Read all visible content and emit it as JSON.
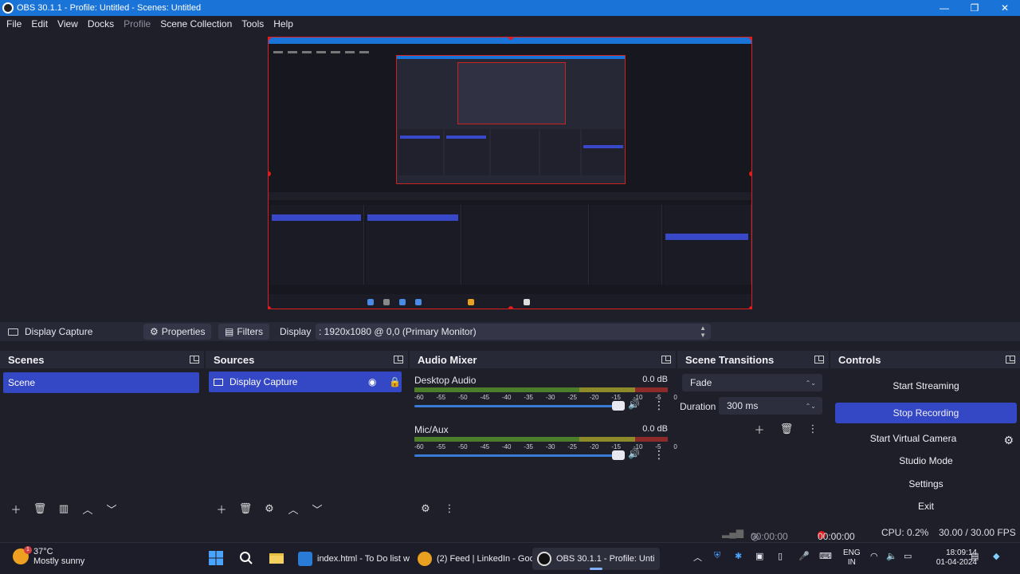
{
  "window": {
    "title": "OBS 30.1.1 - Profile: Untitled - Scenes: Untitled",
    "minimize": "—",
    "maximize": "❐",
    "close": "✕"
  },
  "menu": [
    "File",
    "Edit",
    "View",
    "Docks",
    "Profile",
    "Scene Collection",
    "Tools",
    "Help"
  ],
  "source_toolbar": {
    "source_name": "Display Capture",
    "properties": "Properties",
    "filters": "Filters",
    "display_label": "Display",
    "display_value": ": 1920x1080 @ 0,0 (Primary Monitor)"
  },
  "scenes": {
    "title": "Scenes",
    "items": [
      "Scene"
    ]
  },
  "sources": {
    "title": "Sources",
    "items": [
      "Display Capture"
    ]
  },
  "audio_mixer": {
    "title": "Audio Mixer",
    "channels": [
      {
        "name": "Desktop Audio",
        "db": "0.0 dB",
        "volume": 1.0
      },
      {
        "name": "Mic/Aux",
        "db": "0.0 dB",
        "volume": 1.0
      }
    ],
    "scale": [
      "-60",
      "-55",
      "-50",
      "-45",
      "-40",
      "-35",
      "-30",
      "-25",
      "-20",
      "-15",
      "-10",
      "-5",
      "0"
    ]
  },
  "transitions": {
    "title": "Scene Transitions",
    "selected": "Fade",
    "duration_label": "Duration",
    "duration_value": "300 ms"
  },
  "controls": {
    "title": "Controls",
    "start_streaming": "Start Streaming",
    "stop_recording": "Stop Recording",
    "start_virtual_camera": "Start Virtual Camera",
    "studio_mode": "Studio Mode",
    "settings": "Settings",
    "exit": "Exit"
  },
  "status": {
    "stream_time": "00:00:00",
    "rec_time": "00:00:00",
    "cpu": "CPU: 0.2%",
    "fps": "30.00 / 30.00 FPS"
  },
  "taskbar": {
    "weather_temp": "37°C",
    "weather_desc": "Mostly sunny",
    "weather_badge": "1",
    "apps": [
      {
        "label": "index.html - To Do list w",
        "color": "#2a7bd6"
      },
      {
        "label": "(2) Feed | LinkedIn - Goo",
        "color": "#e8a020"
      },
      {
        "label": "OBS 30.1.1 - Profile: Unti",
        "color": "#e8e8e8"
      }
    ],
    "lang_top": "ENG",
    "lang_bottom": "IN",
    "time": "18:09:14",
    "date": "01-04-2024"
  }
}
